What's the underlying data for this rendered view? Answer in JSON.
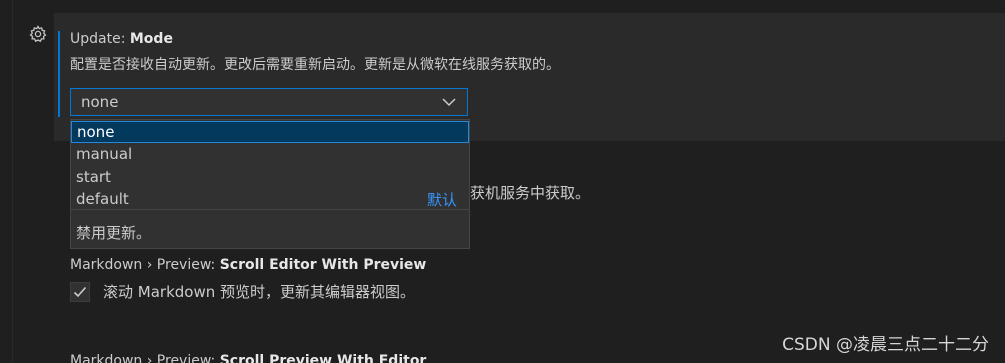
{
  "update_mode": {
    "category": "Update:",
    "name": "Mode",
    "description": "配置是否接收自动更新。更改后需要重新启动。更新是从微软在线服务获取的。",
    "selected_value": "none",
    "options": [
      {
        "label": "none"
      },
      {
        "label": "manual"
      },
      {
        "label": "start"
      },
      {
        "label": "default",
        "tag": "默认"
      }
    ],
    "option_description": "禁用更新。"
  },
  "obscured_text": "获机服务中获取。",
  "scroll_editor": {
    "category": "Markdown › Preview:",
    "name": "Scroll Editor With Preview",
    "checked": true,
    "label": "滚动 Markdown 预览时，更新其编辑器视图。"
  },
  "scroll_preview": {
    "category": "Markdown › Preview:",
    "name": "Scroll Preview With Editor"
  },
  "watermark": "CSDN @凌晨三点二十二分",
  "colors": {
    "accent": "#0078d4",
    "active_option_bg": "#04395e",
    "default_tag": "#3794ff"
  },
  "icons": {
    "settings_gear": "gear-icon",
    "dropdown": "chevron-down-icon",
    "checkbox": "check-icon"
  }
}
